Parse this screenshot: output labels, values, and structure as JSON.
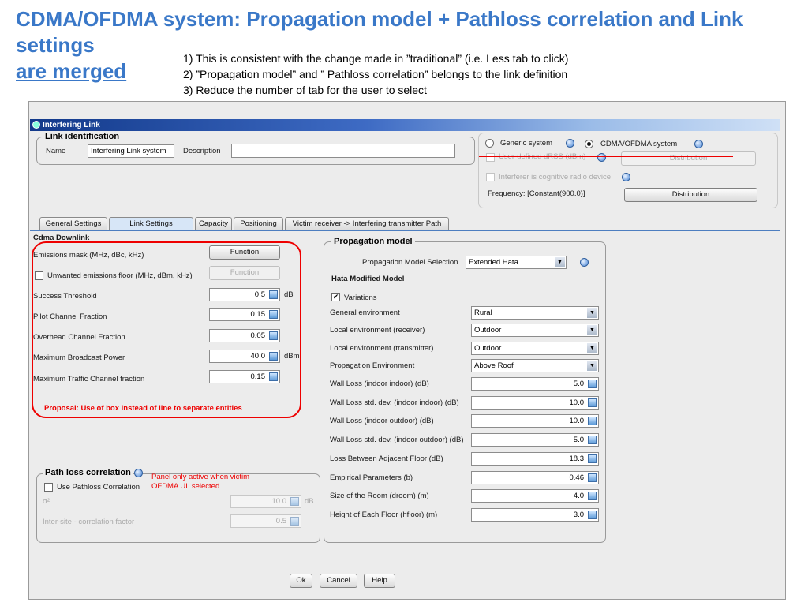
{
  "slide": {
    "title": "CDMA/OFDMA system: Propagation model + Pathloss correlation and Link settings",
    "title_underlined": "are merged",
    "notes": [
      "1) This is consistent with the change made in ”traditional” (i.e. Less tab to click)",
      "2) ”Propagation model” and ” Pathloss correlation” belongs to the link definition",
      "3) Reduce the number of tab for the user to select"
    ]
  },
  "window": {
    "title": "Interfering Link"
  },
  "link_identification": {
    "title": "Link identification",
    "name_label": "Name",
    "name_value": "Interfering Link system",
    "description_label": "Description",
    "description_value": "",
    "generic_label": "Generic system",
    "cdma_label": "CDMA/OFDMA system",
    "user_drss_label": "User-defined dRSS (dBm)",
    "distribution_label_1": "Distribution",
    "cognitive_label": "Interferer is cognitive radio device",
    "frequency_label": "Frequency: [Constant(900.0)]",
    "distribution_label_2": "Distribution"
  },
  "tabs": [
    "General Settings",
    "Link  Settings",
    "Capacity",
    "Positioning",
    "Victim receiver -> Interfering transmitter Path"
  ],
  "cdma_downlink": {
    "title": "Cdma Downlink",
    "emissions_mask_label": "Emissions mask (MHz, dBc, kHz)",
    "function_1": "Function",
    "unwanted_label": "Unwanted emissions floor (MHz, dBm, kHz)",
    "function_2": "Function",
    "success_label": "Success Threshold",
    "success_value": "0.5",
    "success_unit": "dB",
    "pilot_label": "Pilot Channel Fraction",
    "pilot_value": "0.15",
    "overhead_label": "Overhead Channel Fraction",
    "overhead_value": "0.05",
    "max_bcast_label": "Maximum Broadcast Power",
    "max_bcast_value": "40.0",
    "max_bcast_unit": "dBm",
    "max_traffic_label": "Maximum Traffic Channel fraction",
    "max_traffic_value": "0.15",
    "proposal": "Proposal: Use of box instead of line to separate entities"
  },
  "path_loss": {
    "title": "Path loss correlation",
    "use_label": "Use Pathloss Correlation",
    "note_line1": "Panel only active when victim",
    "note_line2": "OFDMA UL selected",
    "sigma_label": "σ²",
    "sigma_value": "10.0",
    "sigma_unit": "dB",
    "inter_site_label": "Inter-site - correlation factor",
    "inter_site_value": "0.5"
  },
  "propagation": {
    "title": "Propagation model",
    "selection_label": "Propagation Model Selection",
    "selection_value": "Extended Hata",
    "hata_label": "Hata Modified Model",
    "variations_label": "Variations",
    "selects": [
      {
        "label": "General environment",
        "value": "Rural"
      },
      {
        "label": "Local environment (receiver)",
        "value": "Outdoor"
      },
      {
        "label": "Local environment (transmitter)",
        "value": "Outdoor"
      },
      {
        "label": "Propagation Environment",
        "value": "Above Roof"
      }
    ],
    "fields": [
      {
        "label": "Wall Loss (indoor indoor) (dB)",
        "value": "5.0"
      },
      {
        "label": "Wall Loss std. dev. (indoor indoor) (dB)",
        "value": "10.0"
      },
      {
        "label": "Wall Loss (indoor outdoor) (dB)",
        "value": "10.0"
      },
      {
        "label": "Wall Loss std. dev. (indoor outdoor) (dB)",
        "value": "5.0"
      },
      {
        "label": "Loss Between Adjacent Floor (dB)",
        "value": "18.3"
      },
      {
        "label": "Empirical Parameters (b)",
        "value": "0.46"
      },
      {
        "label": "Size of the Room (droom) (m)",
        "value": "4.0"
      },
      {
        "label": "Height of Each Floor (hfloor) (m)",
        "value": "3.0"
      }
    ]
  },
  "footer": {
    "ok": "Ok",
    "cancel": "Cancel",
    "help": "Help"
  },
  "colors": {
    "title_blue": "#3a78c8",
    "proposal_red": "#e00000",
    "annotation_red": "#e00000"
  }
}
